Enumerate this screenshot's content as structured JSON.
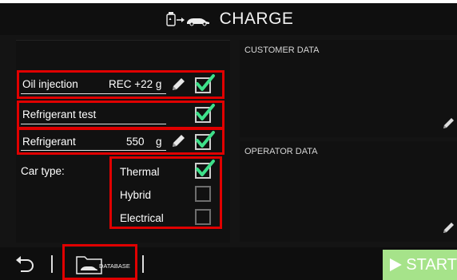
{
  "header": {
    "title": "CHARGE",
    "icon": "charge-car-icon"
  },
  "rows": {
    "oil_injection": {
      "label": "Oil injection",
      "value": "REC +22 g",
      "checked": true
    },
    "refrigerant_test": {
      "label": "Refrigerant test",
      "checked": true
    },
    "refrigerant": {
      "label": "Refrigerant",
      "value": "550",
      "unit": "g",
      "checked": true
    }
  },
  "car_type": {
    "label": "Car type:",
    "options": [
      {
        "label": "Thermal",
        "checked": true
      },
      {
        "label": "Hybrid",
        "checked": false
      },
      {
        "label": "Electrical",
        "checked": false
      }
    ]
  },
  "customer_data": {
    "title": "CUSTOMER DATA"
  },
  "operator_data": {
    "title": "OPERATOR DATA"
  },
  "footer": {
    "database_label": "DATABASE",
    "start_label": "START"
  },
  "colors": {
    "highlight": "#e00000",
    "check": "#3ee08a",
    "start_bg": "#a6e38a"
  }
}
